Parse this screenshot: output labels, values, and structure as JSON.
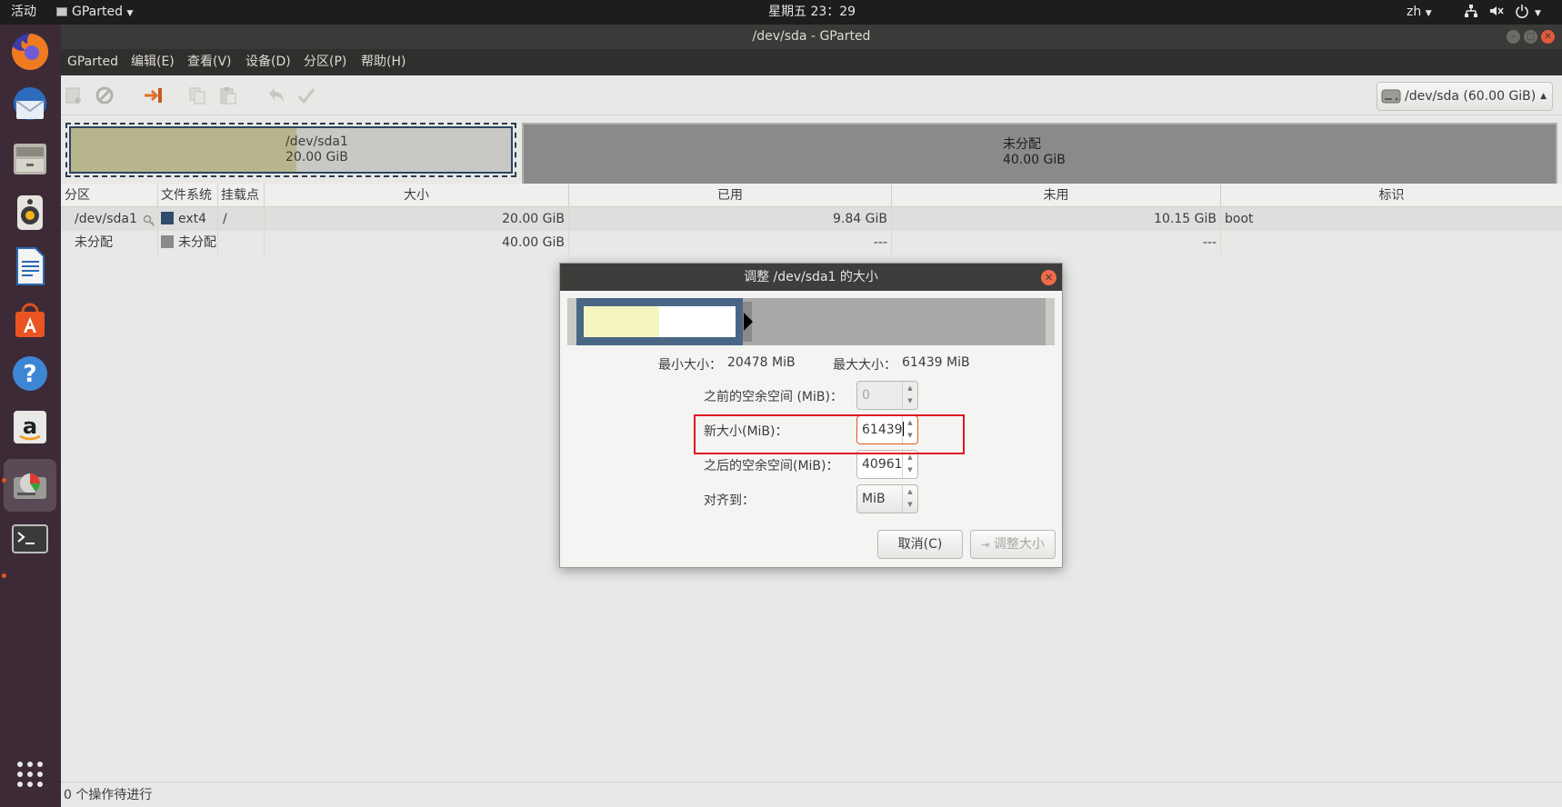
{
  "topbar": {
    "activities": "活动",
    "app_name": "GParted",
    "clock": "星期五 23：29",
    "lang": "zh"
  },
  "window": {
    "title": "/dev/sda - GParted"
  },
  "menu": {
    "gparted": "GParted",
    "edit": "编辑(E)",
    "view": "查看(V)",
    "device": "设备(D)",
    "partition": "分区(P)",
    "help": "帮助(H)"
  },
  "device_selector": {
    "value": "/dev/sda   (60.00 GiB)"
  },
  "disk_map": {
    "sda1_name": "/dev/sda1",
    "sda1_size": "20.00 GiB",
    "unalloc_name": "未分配",
    "unalloc_size": "40.00 GiB"
  },
  "table": {
    "headers": {
      "partition": "分区",
      "filesystem": "文件系统",
      "mountpoint": "挂载点",
      "size": "大小",
      "used": "已用",
      "unused": "未用",
      "flags": "标识"
    },
    "rows": [
      {
        "partition": "/dev/sda1",
        "filesystem": "ext4",
        "fs_color": "#304b6b",
        "mountpoint": "/",
        "size": "20.00 GiB",
        "used": "9.84 GiB",
        "unused": "10.15 GiB",
        "flags": "boot"
      },
      {
        "partition": "未分配",
        "filesystem": "未分配",
        "fs_color": "#8a8a8a",
        "mountpoint": "",
        "size": "40.00 GiB",
        "used": "---",
        "unused": "---",
        "flags": ""
      }
    ]
  },
  "status": {
    "pending": "0 个操作待进行"
  },
  "dialog": {
    "title": "调整 /dev/sda1 的大小",
    "min_label": "最小大小：",
    "min_value": "20478 MiB",
    "max_label": "最大大小：",
    "max_value": "61439 MiB",
    "free_before_label": "之前的空余空间 (MiB)：",
    "free_before_value": "0",
    "new_size_label": "新大小(MiB)：",
    "new_size_value": "61439",
    "free_after_label": "之后的空余空间(MiB)：",
    "free_after_value": "40961",
    "align_label": "对齐到：",
    "align_value": "MiB",
    "cancel_button": "取消(C)",
    "resize_button": "调整大小"
  },
  "colors": {
    "ubuntu_orange": "#e95420",
    "used_space": "#b7b58c",
    "partition_border": "#2c4460",
    "highlight": "#e0141e"
  }
}
